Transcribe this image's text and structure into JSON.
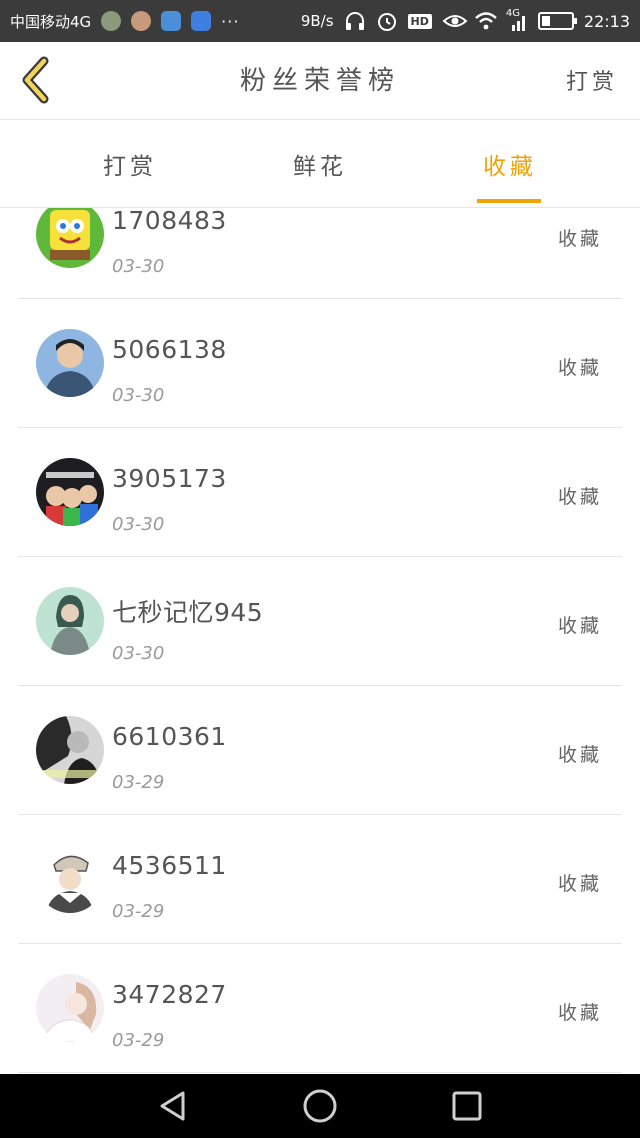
{
  "status_bar": {
    "carrier": "中国移动4G",
    "dots": "···",
    "net_speed": "9B/s",
    "hd": "HD",
    "signal_type": "4G",
    "battery_level": 0.3,
    "time": "22:13"
  },
  "header": {
    "title": "粉丝荣誉榜",
    "right_action": "打赏"
  },
  "tabs": [
    {
      "label": "打赏",
      "active": false
    },
    {
      "label": "鲜花",
      "active": false
    },
    {
      "label": "收藏",
      "active": true
    }
  ],
  "colors": {
    "accent": "#f0a20a",
    "status_bar": "#3b3b3b",
    "divider": "#e6e6e6"
  },
  "list": [
    {
      "name": "1708483",
      "date": "03-30",
      "action": "收藏",
      "avatar": "spongebob-avatar-icon"
    },
    {
      "name": "5066138",
      "date": "03-30",
      "action": "收藏",
      "avatar": "boy-photo-avatar-icon"
    },
    {
      "name": "3905173",
      "date": "03-30",
      "action": "收藏",
      "avatar": "cartoon-group-avatar-icon"
    },
    {
      "name": "七秒记忆945",
      "date": "03-30",
      "action": "收藏",
      "avatar": "girl-photo-avatar-icon"
    },
    {
      "name": "6610361",
      "date": "03-29",
      "action": "收藏",
      "avatar": "bw-man-avatar-icon"
    },
    {
      "name": "4536511",
      "date": "03-29",
      "action": "收藏",
      "avatar": "anime-boy-avatar-icon"
    },
    {
      "name": "3472827",
      "date": "03-29",
      "action": "收藏",
      "avatar": "pale-girl-avatar-icon"
    }
  ]
}
